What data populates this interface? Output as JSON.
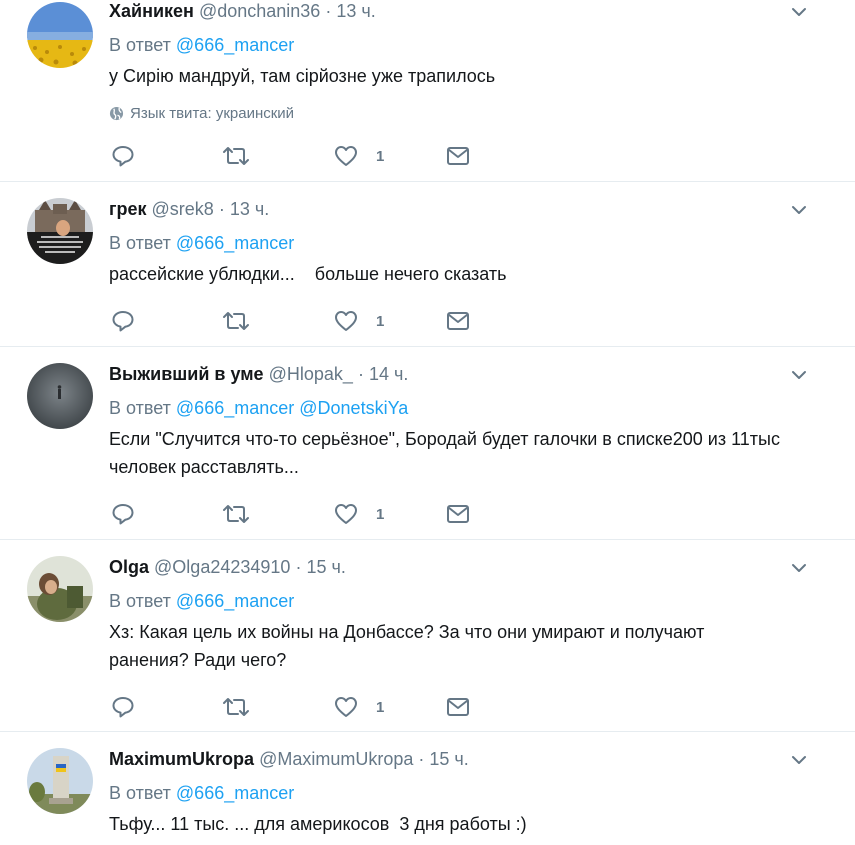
{
  "reply_prefix": "В ответ",
  "tweets": [
    {
      "name": "Хайникен",
      "handle": "@donchanin36",
      "sep": "·",
      "time": "13 ч.",
      "reply_to": [
        "@666_mancer"
      ],
      "text": "у Сирію мандруй, там сірйозне уже трапилось",
      "language": "Язык твита: украинский",
      "likes": "1",
      "avatar": "sunflower-field-avatar"
    },
    {
      "name": "грек",
      "handle": "@srek8",
      "sep": "·",
      "time": "13 ч.",
      "reply_to": [
        "@666_mancer"
      ],
      "text": "рассейские ублюдки...    больше нечего сказать",
      "likes": "1",
      "avatar": "castle-photo-avatar"
    },
    {
      "name": "Выживший в уме",
      "handle": "@Hlopak_",
      "sep": "·",
      "time": "14 ч.",
      "reply_to": [
        "@666_mancer",
        "@DonetskiYa"
      ],
      "text": "Если \"Случится что-то серьёзное\", Бородай будет галочки в списке200 из 11тыс человек расставлять...",
      "likes": "1",
      "avatar": "foggy-figure-avatar"
    },
    {
      "name": "Olga",
      "handle": "@Olga24234910",
      "sep": "·",
      "time": "15 ч.",
      "reply_to": [
        "@666_mancer"
      ],
      "text": "Хз: Какая цель их войны на Донбассе? За что они умирают и получают ранения? Ради чего?",
      "likes": "1",
      "avatar": "soldier-photo-avatar"
    },
    {
      "name": "MaximumUkropa",
      "handle": "@MaximumUkropa",
      "sep": "·",
      "time": "15 ч.",
      "reply_to": [
        "@666_mancer"
      ],
      "text": "Тьфу... 11 тыс. ... для америкосов  3 дня работы :)",
      "avatar": "monument-photo-avatar"
    }
  ],
  "colors": {
    "text": "#14171a",
    "secondary": "#657786",
    "link": "#1da1f2",
    "border": "#e6ecf0"
  }
}
